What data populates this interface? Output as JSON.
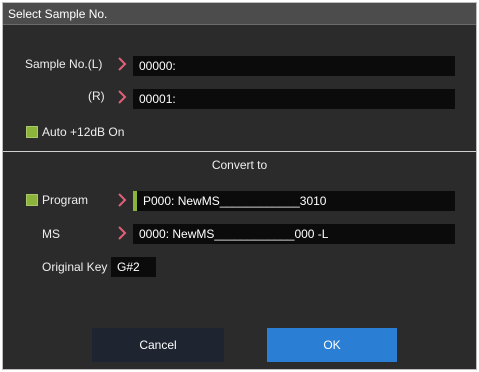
{
  "dialog": {
    "title": "Select Sample No."
  },
  "sample": {
    "left_label": "Sample No.(L)",
    "left_value": "00000:",
    "right_label": "(R)",
    "right_value": "00001:",
    "auto_label": "Auto +12dB On"
  },
  "convert": {
    "heading": "Convert to",
    "program_label": "Program",
    "program_value": "P000: NewMS____________3010",
    "ms_label": "MS",
    "ms_value": "0000: NewMS____________000 -L",
    "original_key_label": "Original Key",
    "original_key_value": "G#2"
  },
  "buttons": {
    "cancel": "Cancel",
    "ok": "OK"
  },
  "colors": {
    "background": "#2b2b2b",
    "title_bar": "#4c4c4c",
    "field": "#0b0b0b",
    "accent_chevron": "#e0607a",
    "checkbox_green": "#8cb43a",
    "ok_button": "#2a7fd4",
    "cancel_button": "#1e2430"
  },
  "icons": {
    "chevron": "chevron-right-icon"
  }
}
